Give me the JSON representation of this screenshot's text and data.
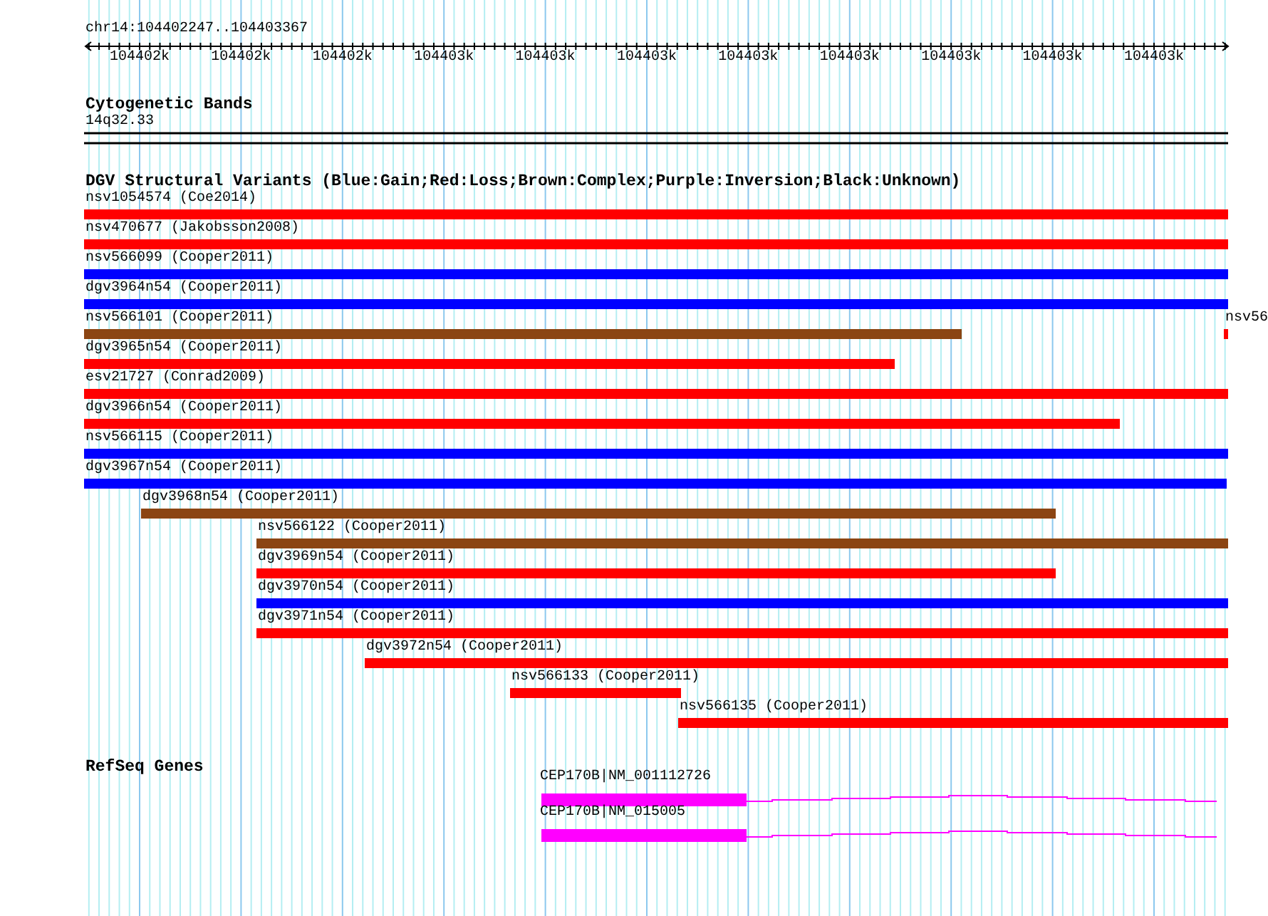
{
  "ruler": {
    "location": "chr14:104402247..104403367",
    "tick_labels": [
      "104402k",
      "104402k",
      "104402k",
      "104403k",
      "104403k",
      "104403k",
      "104403k",
      "104403k",
      "104403k",
      "104403k",
      "104403k"
    ]
  },
  "tracks": [
    {
      "kind": "bands",
      "title": "Cytogenetic Bands",
      "features": [
        {
          "label": "14q32.33"
        }
      ]
    },
    {
      "kind": "variants",
      "title": "DGV Structural Variants (Blue:Gain;Red:Loss;Brown:Complex;Purple:Inversion;Black:Unknown)",
      "features": [
        {
          "label": "nsv1054574 (Coe2014)",
          "color": "#ff0000"
        },
        {
          "label": "nsv470677 (Jakobsson2008)",
          "color": "#ff0000"
        },
        {
          "label": "nsv566099 (Cooper2011)",
          "color": "#0000ff"
        },
        {
          "label": "dgv3964n54 (Cooper2011)",
          "color": "#0000ff"
        },
        {
          "label": "nsv566101 (Cooper2011)",
          "color": "#8b4513"
        },
        {
          "label": "nsv56",
          "color": "#ff0000"
        },
        {
          "label": "dgv3965n54 (Cooper2011)",
          "color": "#ff0000"
        },
        {
          "label": "esv21727 (Conrad2009)",
          "color": "#ff0000"
        },
        {
          "label": "dgv3966n54 (Cooper2011)",
          "color": "#ff0000"
        },
        {
          "label": "nsv566115 (Cooper2011)",
          "color": "#0000ff"
        },
        {
          "label": "dgv3967n54 (Cooper2011)",
          "color": "#0000ff"
        },
        {
          "label": "dgv3968n54 (Cooper2011)",
          "color": "#8b4513"
        },
        {
          "label": "nsv566122 (Cooper2011)",
          "color": "#8b4513"
        },
        {
          "label": "dgv3969n54 (Cooper2011)",
          "color": "#ff0000"
        },
        {
          "label": "dgv3970n54 (Cooper2011)",
          "color": "#0000ff"
        },
        {
          "label": "dgv3971n54 (Cooper2011)",
          "color": "#ff0000"
        },
        {
          "label": "dgv3972n54 (Cooper2011)",
          "color": "#ff0000"
        },
        {
          "label": "nsv566133 (Cooper2011)",
          "color": "#ff0000"
        },
        {
          "label": "nsv566135 (Cooper2011)",
          "color": "#ff0000"
        }
      ]
    },
    {
      "kind": "genes",
      "title": "RefSeq Genes",
      "features": [
        {
          "label": "CEP170B|NM_001112726"
        },
        {
          "label": "CEP170B|NM_015005"
        }
      ]
    }
  ]
}
